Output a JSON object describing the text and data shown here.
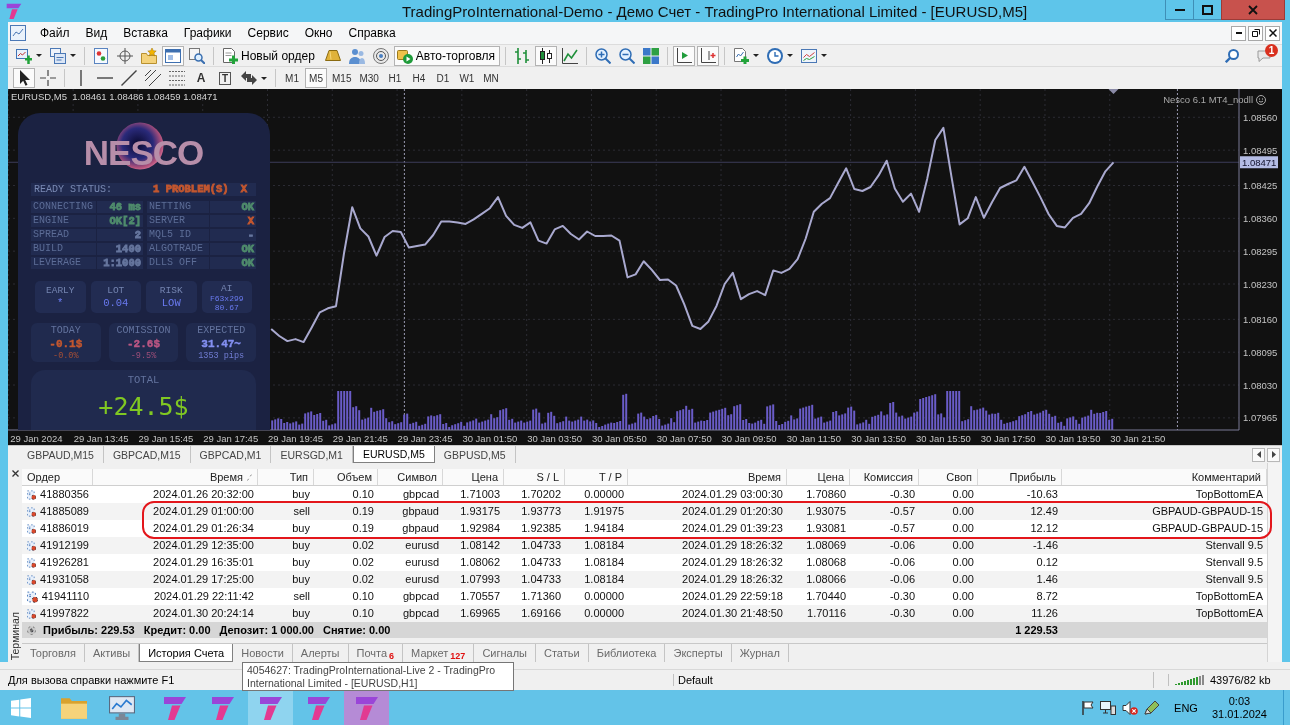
{
  "title_bar": {
    "title": "TradingProInternational-Demo - Демо Счет - TradingPro International Limited - [EURUSD,M5]"
  },
  "menu": [
    "Файл",
    "Вид",
    "Вставка",
    "Графики",
    "Сервис",
    "Окно",
    "Справка"
  ],
  "toolbar": {
    "groups": [
      [
        {
          "kind": "newchart",
          "pressed": false
        },
        {
          "kind": "profiles",
          "pressed": false
        }
      ],
      [
        {
          "kind": "marketwatch",
          "pressed": false
        },
        {
          "kind": "datawindow",
          "pressed": false
        },
        {
          "kind": "favorites",
          "pressed": false
        },
        {
          "kind": "terminal",
          "pressed": true
        },
        {
          "kind": "tester",
          "pressed": false
        }
      ],
      [
        {
          "kind": "order",
          "label": "Новый ордер",
          "pressed": false
        },
        {
          "kind": "ingot",
          "pressed": false
        },
        {
          "kind": "people",
          "pressed": false
        },
        {
          "kind": "signal",
          "pressed": false
        },
        {
          "kind": "autotrade",
          "label": "Авто-торговля",
          "pressed": true
        }
      ],
      [
        {
          "kind": "bars",
          "pressed": false
        },
        {
          "kind": "candles",
          "pressed": true
        },
        {
          "kind": "line",
          "pressed": false
        }
      ],
      [
        {
          "kind": "zoomin",
          "pressed": false
        },
        {
          "kind": "zoomout",
          "pressed": false
        },
        {
          "kind": "tile",
          "pressed": false
        }
      ],
      [
        {
          "kind": "autoscroll",
          "pressed": true
        },
        {
          "kind": "shift",
          "pressed": true
        }
      ],
      [
        {
          "kind": "indicators",
          "pressed": false
        },
        {
          "kind": "periods",
          "pressed": false
        },
        {
          "kind": "templates",
          "pressed": false
        }
      ]
    ],
    "notification_count": "1"
  },
  "toolbar2": {
    "groups": [
      [
        {
          "kind": "cursor",
          "pressed": true
        },
        {
          "kind": "crosshair",
          "pressed": false
        }
      ],
      [
        {
          "kind": "vline",
          "pressed": false
        },
        {
          "kind": "hline",
          "pressed": false
        },
        {
          "kind": "trendline",
          "pressed": false
        },
        {
          "kind": "channel",
          "pressed": false
        },
        {
          "kind": "fibo",
          "pressed": false
        },
        {
          "kind": "text",
          "glyph": "A",
          "pressed": false
        },
        {
          "kind": "label",
          "glyph": "T",
          "pressed": false
        },
        {
          "kind": "arrows",
          "pressed": false
        }
      ]
    ],
    "timeframes": [
      {
        "label": "M1",
        "selected": false
      },
      {
        "label": "M5",
        "selected": true
      },
      {
        "label": "M15",
        "selected": false
      },
      {
        "label": "M30",
        "selected": false
      },
      {
        "label": "H1",
        "selected": false
      },
      {
        "label": "H4",
        "selected": false
      },
      {
        "label": "D1",
        "selected": false
      },
      {
        "label": "W1",
        "selected": false
      },
      {
        "label": "MN",
        "selected": false
      }
    ]
  },
  "chart": {
    "symbol_info": "EURUSD,M5  1.08461 1.08486 1.08459 1.08471",
    "indicator_label": "Nesco 6.1 MT4_nodll",
    "chart_data": {
      "type": "line",
      "grid": true,
      "categories": [
        null,
        null,
        null,
        "29 Jan 2024",
        null,
        null,
        null,
        null,
        null,
        null,
        null,
        "29 Jan 13:45",
        null,
        null,
        null,
        null,
        null,
        null,
        null,
        "29 Jan 15:45",
        null,
        null,
        null,
        null,
        null,
        null,
        null,
        "29 Jan 17:45",
        null,
        null,
        null,
        null,
        null,
        null,
        null,
        "29 Jan 19:45",
        null,
        null,
        null,
        null,
        null,
        null,
        null,
        "29 Jan 21:45",
        null,
        null,
        null,
        null,
        null,
        null,
        null,
        "29 Jan 23:45",
        null,
        null,
        null,
        null,
        null,
        null,
        null,
        "30 Jan 01:50",
        null,
        null,
        null,
        null,
        null,
        null,
        null,
        "30 Jan 03:50",
        null,
        null,
        null,
        null,
        null,
        null,
        null,
        "30 Jan 05:50",
        null,
        null,
        null,
        null,
        null,
        null,
        null,
        "30 Jan 07:50",
        null,
        null,
        null,
        null,
        null,
        null,
        null,
        "30 Jan 09:50",
        null,
        null,
        null,
        null,
        null,
        null,
        null,
        "30 Jan 11:50",
        null,
        null,
        null,
        null,
        null,
        null,
        null,
        "30 Jan 13:50",
        null,
        null,
        null,
        null,
        null,
        null,
        null,
        "30 Jan 15:50",
        null,
        null,
        null,
        null,
        null,
        null,
        null,
        "30 Jan 17:50",
        null,
        null,
        null,
        null,
        null,
        null,
        null,
        "30 Jan 19:50",
        null,
        null,
        null,
        null,
        null,
        null,
        null,
        "30 Jan 21:50",
        null,
        null,
        null,
        null,
        null,
        null,
        null,
        null,
        null,
        null,
        null,
        null
      ],
      "series": [
        {
          "color": "#a9a9cf",
          "values": [
            null,
            null,
            null,
            null,
            null,
            null,
            null,
            null,
            null,
            null,
            null,
            null,
            null,
            null,
            null,
            null,
            null,
            null,
            null,
            null,
            null,
            null,
            null,
            null,
            null,
            null,
            null,
            null,
            null,
            null,
            null,
            null,
            1.08141,
            1.08127,
            1.08117,
            1.08121,
            1.08115,
            1.08144,
            1.08174,
            1.08182,
            1.08186,
            1.08292,
            1.08382,
            1.0834,
            1.08324,
            1.08286,
            1.08323,
            1.08335,
            1.08333,
            1.08302,
            1.08305,
            1.08308,
            1.08327,
            1.08354,
            1.08354,
            1.08352,
            1.08349,
            1.08358,
            1.08369,
            1.0838,
            1.08402,
            1.08365,
            1.08347,
            1.08341,
            1.08352,
            1.08316,
            1.0831,
            1.08338,
            1.08345,
            1.08329,
            1.08318,
            1.08334,
            1.08325,
            1.08325,
            1.08326,
            1.08316,
            1.08243,
            1.08249,
            1.08275,
            1.08258,
            1.08238,
            1.08239,
            1.08227,
            1.0819,
            1.08147,
            1.08141,
            1.08156,
            1.08187,
            1.0823,
            1.08252,
            1.082,
            1.0821,
            1.08216,
            1.08208,
            1.08257,
            1.08252,
            1.0826,
            1.08279,
            1.0832,
            1.08373,
            1.08389,
            1.084,
            1.0843,
            1.08459,
            1.08418,
            1.08414,
            1.08422,
            1.08445,
            1.08474,
            1.08419,
            1.08393,
            1.08409,
            1.08373,
            1.08438,
            1.08515,
            1.08539,
            1.08442,
            1.08348,
            1.0836,
            1.08402,
            1.08361,
            1.08392,
            1.0842,
            1.08428,
            1.08435,
            1.08462,
            1.08432,
            1.08401,
            1.08368,
            1.08345,
            1.08342,
            1.08361,
            1.08369,
            1.0839,
            1.08423,
            1.08453,
            1.08471,
            null,
            null,
            null,
            null,
            null,
            null,
            null,
            null,
            null,
            null,
            null,
            null,
            null,
            null,
            null
          ]
        }
      ],
      "ylim": [
        1.07941,
        1.08616
      ],
      "yticks": [
        {
          "value": 1.07965,
          "label": "1.07965"
        },
        {
          "value": 1.0803,
          "label": "1.08030"
        },
        {
          "value": 1.08095,
          "label": "1.08095"
        },
        {
          "value": 1.0816,
          "label": "1.08160"
        },
        {
          "value": 1.0823,
          "label": "1.08230"
        },
        {
          "value": 1.08295,
          "label": "1.08295"
        },
        {
          "value": 1.0836,
          "label": "1.08360"
        },
        {
          "value": 1.08425,
          "label": "1.08425"
        },
        {
          "value": 1.08495,
          "label": "1.08495"
        },
        {
          "value": 1.0856,
          "label": "1.08560"
        }
      ],
      "ref_lines": [
        {
          "axis": "y",
          "value": 1.08471,
          "label": "1.08471"
        }
      ]
    }
  },
  "nesco_panel": {
    "logo": "NESCO",
    "status": {
      "label": "READY STATUS:",
      "value": "1 PROBLEM(S)",
      "flag": "X",
      "color": "#c4572f"
    },
    "checks": [
      {
        "label": "CONNECTING",
        "value": "46 ms",
        "color": "#4f8c6c"
      },
      {
        "label": "NETTING",
        "value": "OK",
        "color": "#4f8c6c"
      },
      {
        "label": "ENGINE",
        "value": "OK[2]",
        "color": "#4f8c6c"
      },
      {
        "label": "SERVER",
        "value": "X",
        "color": "#c4572f"
      },
      {
        "label": "SPREAD",
        "value": "2",
        "color": "#66769e"
      },
      {
        "label": "MQL5 ID",
        "value": "-",
        "color": "#66769e"
      },
      {
        "label": "BUILD",
        "value": "1400",
        "color": "#66769e"
      },
      {
        "label": "ALGOTRADE",
        "value": "OK",
        "color": "#4f8c6c"
      },
      {
        "label": "LEVERAGE",
        "value": "1:1000",
        "color": "#66769e"
      },
      {
        "label": "DLLS OFF",
        "value": "OK",
        "color": "#4f8c6c"
      }
    ],
    "settings": [
      {
        "label": "EARLY",
        "value": "*"
      },
      {
        "label": "LOT",
        "value": "0.04"
      },
      {
        "label": "RISK",
        "value": "LOW"
      },
      {
        "label": "AI",
        "value": "F63x299",
        "detail": "80.67"
      }
    ],
    "stats": [
      {
        "label": "TODAY",
        "value": "-0.1$",
        "detail": "-0.0%",
        "color": "#c4572f"
      },
      {
        "label": "COMISSION",
        "value": "-2.6$",
        "detail": "-9.5%",
        "color": "#bb5683"
      },
      {
        "label": "EXPECTED",
        "value": "31.47~",
        "detail": "1353 pips",
        "color": "#8490f2"
      }
    ],
    "total": {
      "label": "TOTAL",
      "value": "+24.5$",
      "color": "#80c822"
    }
  },
  "chart_tabs": [
    {
      "label": "GBPAUD,M15",
      "selected": false
    },
    {
      "label": "GBPCAD,M15",
      "selected": false
    },
    {
      "label": "GBPCAD,M1",
      "selected": false
    },
    {
      "label": "EURSGD,M1",
      "selected": false
    },
    {
      "label": "EURUSD,M5",
      "selected": true
    },
    {
      "label": "GBPUSD,M5",
      "selected": false
    }
  ],
  "terminal": {
    "side_label": "Терминал",
    "columns": [
      {
        "label": "Ордер",
        "sorted": false
      },
      {
        "label": "Время",
        "sorted": true
      },
      {
        "label": "Тип",
        "sorted": false
      },
      {
        "label": "Объем",
        "sorted": false
      },
      {
        "label": "Символ",
        "sorted": false
      },
      {
        "label": "Цена",
        "sorted": false
      },
      {
        "label": "S / L",
        "sorted": false
      },
      {
        "label": "T / P",
        "sorted": false
      },
      {
        "label": "Время",
        "sorted": false
      },
      {
        "label": "Цена",
        "sorted": false
      },
      {
        "label": "Комиссия",
        "sorted": false
      },
      {
        "label": "Своп",
        "sorted": false
      },
      {
        "label": "Прибыль",
        "sorted": false
      },
      {
        "label": "Комментарий",
        "sorted": false
      }
    ],
    "rows": [
      {
        "cells": [
          "41880356",
          "2024.01.26 20:32:00",
          "buy",
          "0.10",
          "gbpcad",
          "1.71003",
          "1.70202",
          "0.00000",
          "2024.01.29 03:00:30",
          "1.70860",
          "-0.30",
          "0.00",
          "-10.63",
          "TopBottomEA"
        ],
        "circled": false
      },
      {
        "cells": [
          "41885089",
          "2024.01.29 01:00:00",
          "sell",
          "0.19",
          "gbpaud",
          "1.93175",
          "1.93773",
          "1.91975",
          "2024.01.29 01:20:30",
          "1.93075",
          "-0.57",
          "0.00",
          "12.49",
          "GBPAUD-GBPAUD-15"
        ],
        "circled": true
      },
      {
        "cells": [
          "41886019",
          "2024.01.29 01:26:34",
          "buy",
          "0.19",
          "gbpaud",
          "1.92984",
          "1.92385",
          "1.94184",
          "2024.01.29 01:39:23",
          "1.93081",
          "-0.57",
          "0.00",
          "12.12",
          "GBPAUD-GBPAUD-15"
        ],
        "circled": true
      },
      {
        "cells": [
          "41912199",
          "2024.01.29 12:35:00",
          "buy",
          "0.02",
          "eurusd",
          "1.08142",
          "1.04733",
          "1.08184",
          "2024.01.29 18:26:32",
          "1.08069",
          "-0.06",
          "0.00",
          "-1.46",
          "Stenvall 9.5"
        ],
        "circled": false
      },
      {
        "cells": [
          "41926281",
          "2024.01.29 16:35:01",
          "buy",
          "0.02",
          "eurusd",
          "1.08062",
          "1.04733",
          "1.08184",
          "2024.01.29 18:26:32",
          "1.08068",
          "-0.06",
          "0.00",
          "0.12",
          "Stenvall 9.5"
        ],
        "circled": false
      },
      {
        "cells": [
          "41931058",
          "2024.01.29 17:25:00",
          "buy",
          "0.02",
          "eurusd",
          "1.07993",
          "1.04733",
          "1.08184",
          "2024.01.29 18:26:32",
          "1.08066",
          "-0.06",
          "0.00",
          "1.46",
          "Stenvall 9.5"
        ],
        "circled": false
      },
      {
        "cells": [
          "41941110",
          "2024.01.29 22:11:42",
          "sell",
          "0.10",
          "gbpcad",
          "1.70557",
          "1.71360",
          "0.00000",
          "2024.01.29 22:59:18",
          "1.70440",
          "-0.30",
          "0.00",
          "8.72",
          "TopBottomEA"
        ],
        "circled": false
      },
      {
        "cells": [
          "41997822",
          "2024.01.30 20:24:14",
          "buy",
          "0.10",
          "gbpcad",
          "1.69965",
          "1.69166",
          "0.00000",
          "2024.01.30 21:48:50",
          "1.70116",
          "-0.30",
          "0.00",
          "11.26",
          "TopBottomEA"
        ],
        "circled": false
      }
    ],
    "summary": {
      "items": [
        "Прибыль: 229.53",
        "Кредит: 0.00",
        "Депозит: 1 000.00",
        "Снятие: 0.00"
      ],
      "profit": "1 229.53"
    },
    "tabs": [
      {
        "label": "Торговля",
        "selected": false
      },
      {
        "label": "Активы",
        "selected": false
      },
      {
        "label": "История Счета",
        "selected": true
      },
      {
        "label": "Новости",
        "selected": false
      },
      {
        "label": "Алерты",
        "selected": false
      },
      {
        "label": "Почта",
        "badge": "6",
        "selected": false
      },
      {
        "label": "Маркет",
        "badge": "127",
        "selected": false
      },
      {
        "label": "Сигналы",
        "selected": false
      },
      {
        "label": "Статьи",
        "selected": false
      },
      {
        "label": "Библиотека",
        "selected": false
      },
      {
        "label": "Эксперты",
        "selected": false
      },
      {
        "label": "Журнал",
        "selected": false
      }
    ]
  },
  "status_bar": {
    "help": "Для вызова справки нажмите F1",
    "profile": "Default",
    "traffic": "43976/82 kb"
  },
  "tooltip": "4054627: TradingProInternational-Live 2 - TradingPro International Limited - [EURUSD,H1]",
  "taskbar": {
    "items": [
      {
        "kind": "start",
        "hovered": false,
        "selected": false
      },
      {
        "kind": "folder",
        "hovered": false,
        "selected": false
      },
      {
        "kind": "monitor",
        "hovered": false,
        "selected": false
      },
      {
        "kind": "app",
        "hovered": false,
        "selected": false
      },
      {
        "kind": "app",
        "hovered": false,
        "selected": false
      },
      {
        "kind": "app",
        "hovered": true,
        "selected": false
      },
      {
        "kind": "app",
        "hovered": false,
        "selected": false
      },
      {
        "kind": "app",
        "hovered": false,
        "selected": true
      }
    ],
    "language": "ENG",
    "time": "0:03",
    "date": "31.01.2024"
  }
}
